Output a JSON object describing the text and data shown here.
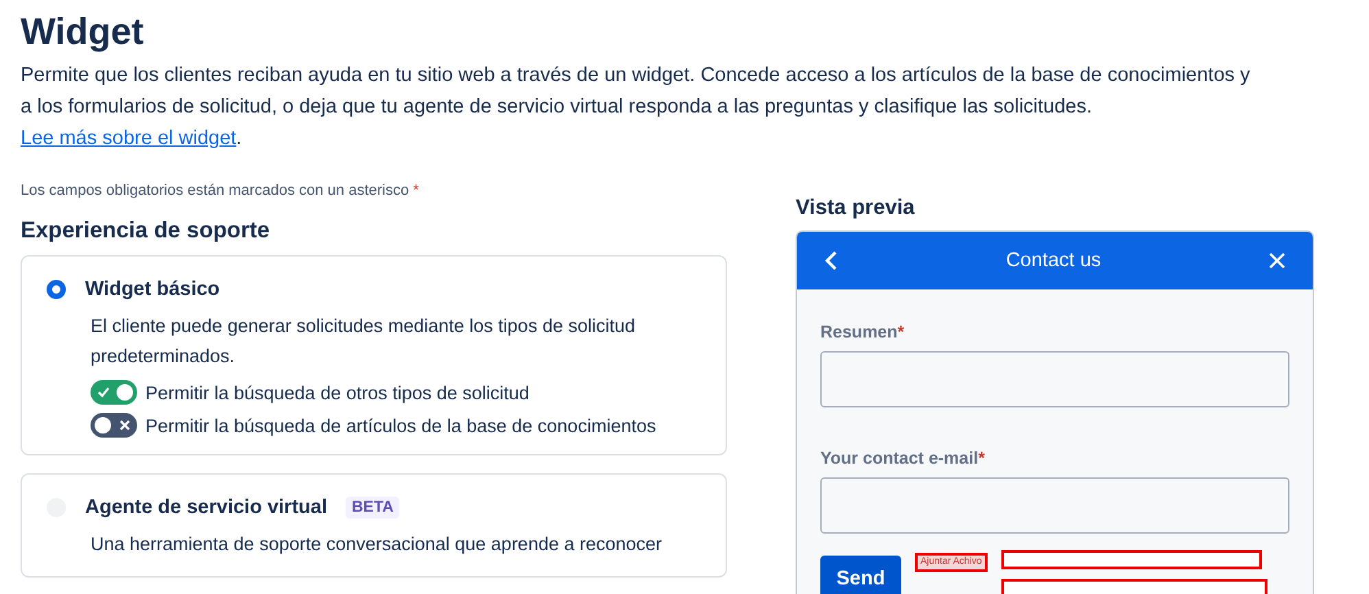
{
  "page": {
    "title": "Widget",
    "description": "Permite que los clientes reciban ayuda en tu sitio web a través de un widget. Concede acceso a los artículos de la base de conocimientos y a los formularios de solicitud, o deja que tu agente de servicio virtual responda a las preguntas y clasifique las solicitudes.",
    "link": "Lee más sobre el widget",
    "link_end": ".",
    "required_note": "Los campos obligatorios están marcados con un asterisco",
    "required_mark": "*"
  },
  "section": {
    "title": "Experiencia de soporte",
    "options": [
      {
        "label": "Widget básico",
        "selected": true,
        "description": "El cliente puede generar solicitudes mediante los tipos de solicitud predeterminados.",
        "toggles": [
          {
            "label": "Permitir la búsqueda de otros tipos de solicitud",
            "on": true
          },
          {
            "label": "Permitir la búsqueda de artículos de la base de conocimientos",
            "on": false
          }
        ]
      },
      {
        "label": "Agente de servicio virtual",
        "badge": "BETA",
        "selected": false,
        "description": "Una herramienta de soporte conversacional que aprende a reconocer"
      }
    ]
  },
  "preview": {
    "title": "Vista previa",
    "header": "Contact us",
    "fields": [
      {
        "label": "Resumen",
        "mark": "*"
      },
      {
        "label": "Your contact e-mail",
        "mark": "*"
      }
    ],
    "submit": "Send",
    "annotation": "Ajuntar Achivo"
  }
}
